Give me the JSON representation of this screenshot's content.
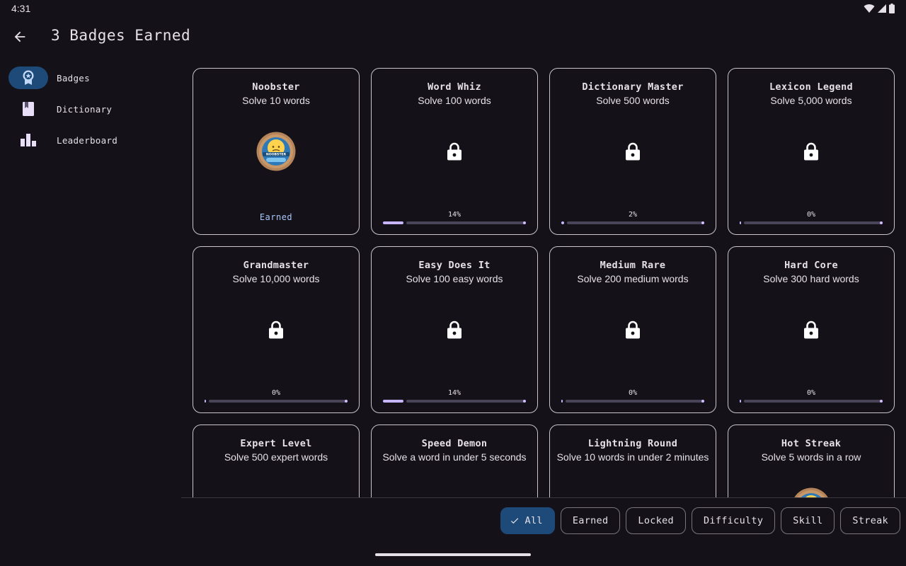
{
  "status": {
    "time": "4:31"
  },
  "header": {
    "title": "3 Badges Earned"
  },
  "nav": {
    "items": [
      {
        "label": "Badges",
        "icon": "badge-icon",
        "active": true
      },
      {
        "label": "Dictionary",
        "icon": "book-icon",
        "active": false
      },
      {
        "label": "Leaderboard",
        "icon": "bar-chart-icon",
        "active": false
      }
    ]
  },
  "badges": [
    {
      "title": "Noobster",
      "desc": "Solve 10 words",
      "earned": true,
      "status": "Earned",
      "medal_text": "NOOBSTER"
    },
    {
      "title": "Word Whiz",
      "desc": "Solve 100 words",
      "earned": false,
      "progress": "14%",
      "progress_value": 14
    },
    {
      "title": "Dictionary Master",
      "desc": "Solve 500 words",
      "earned": false,
      "progress": "2%",
      "progress_value": 2
    },
    {
      "title": "Lexicon Legend",
      "desc": "Solve 5,000 words",
      "earned": false,
      "progress": "0%",
      "progress_value": 0
    },
    {
      "title": "Grandmaster",
      "desc": "Solve 10,000 words",
      "earned": false,
      "progress": "0%",
      "progress_value": 0
    },
    {
      "title": "Easy Does It",
      "desc": "Solve 100 easy words",
      "earned": false,
      "progress": "14%",
      "progress_value": 14
    },
    {
      "title": "Medium Rare",
      "desc": "Solve 200 medium words",
      "earned": false,
      "progress": "0%",
      "progress_value": 0
    },
    {
      "title": "Hard Core",
      "desc": "Solve 300 hard words",
      "earned": false,
      "progress": "0%",
      "progress_value": 0
    },
    {
      "title": "Expert Level",
      "desc": "Solve 500 expert words",
      "earned": false
    },
    {
      "title": "Speed Demon",
      "desc": "Solve a word in under 5 seconds",
      "earned": false
    },
    {
      "title": "Lightning Round",
      "desc": "Solve 10 words in under 2 minutes",
      "earned": false
    },
    {
      "title": "Hot Streak",
      "desc": "Solve 5 words in a row",
      "earned": true
    }
  ],
  "filters": {
    "chips": [
      {
        "label": "All",
        "selected": true
      },
      {
        "label": "Earned",
        "selected": false
      },
      {
        "label": "Locked",
        "selected": false
      },
      {
        "label": "Difficulty",
        "selected": false
      },
      {
        "label": "Skill",
        "selected": false
      },
      {
        "label": "Streak",
        "selected": false
      }
    ]
  },
  "colors": {
    "background": "#141218",
    "accent": "#1e4a7a",
    "progress": "#c7b6ff",
    "earned_text": "#a8c7fa"
  }
}
